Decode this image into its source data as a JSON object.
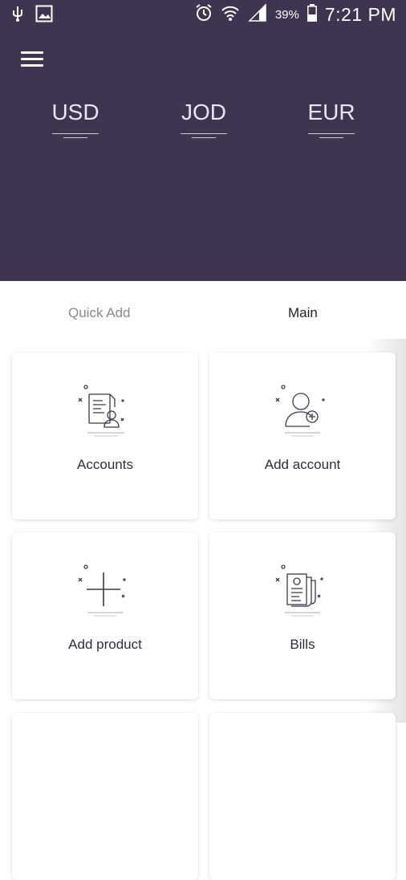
{
  "status_bar": {
    "battery": "39%",
    "time": "7:21 PM",
    "icons": [
      "usb-icon",
      "gallery-icon",
      "alarm-icon",
      "wifi-icon",
      "signal-icon",
      "battery-icon"
    ]
  },
  "header": {
    "currencies": [
      "USD",
      "JOD",
      "EUR"
    ]
  },
  "tabs": {
    "quick_add": "Quick Add",
    "main": "Main",
    "active": "Main"
  },
  "cards": [
    {
      "label": "Accounts",
      "icon": "accounts-icon"
    },
    {
      "label": "Add account",
      "icon": "add-account-icon"
    },
    {
      "label": "Add product",
      "icon": "add-product-icon"
    },
    {
      "label": "Bills",
      "icon": "bills-icon"
    }
  ],
  "colors": {
    "header_bg": "#3f3551",
    "icon_stroke": "#3a3a48",
    "tab_inactive": "#8b8b8b"
  }
}
